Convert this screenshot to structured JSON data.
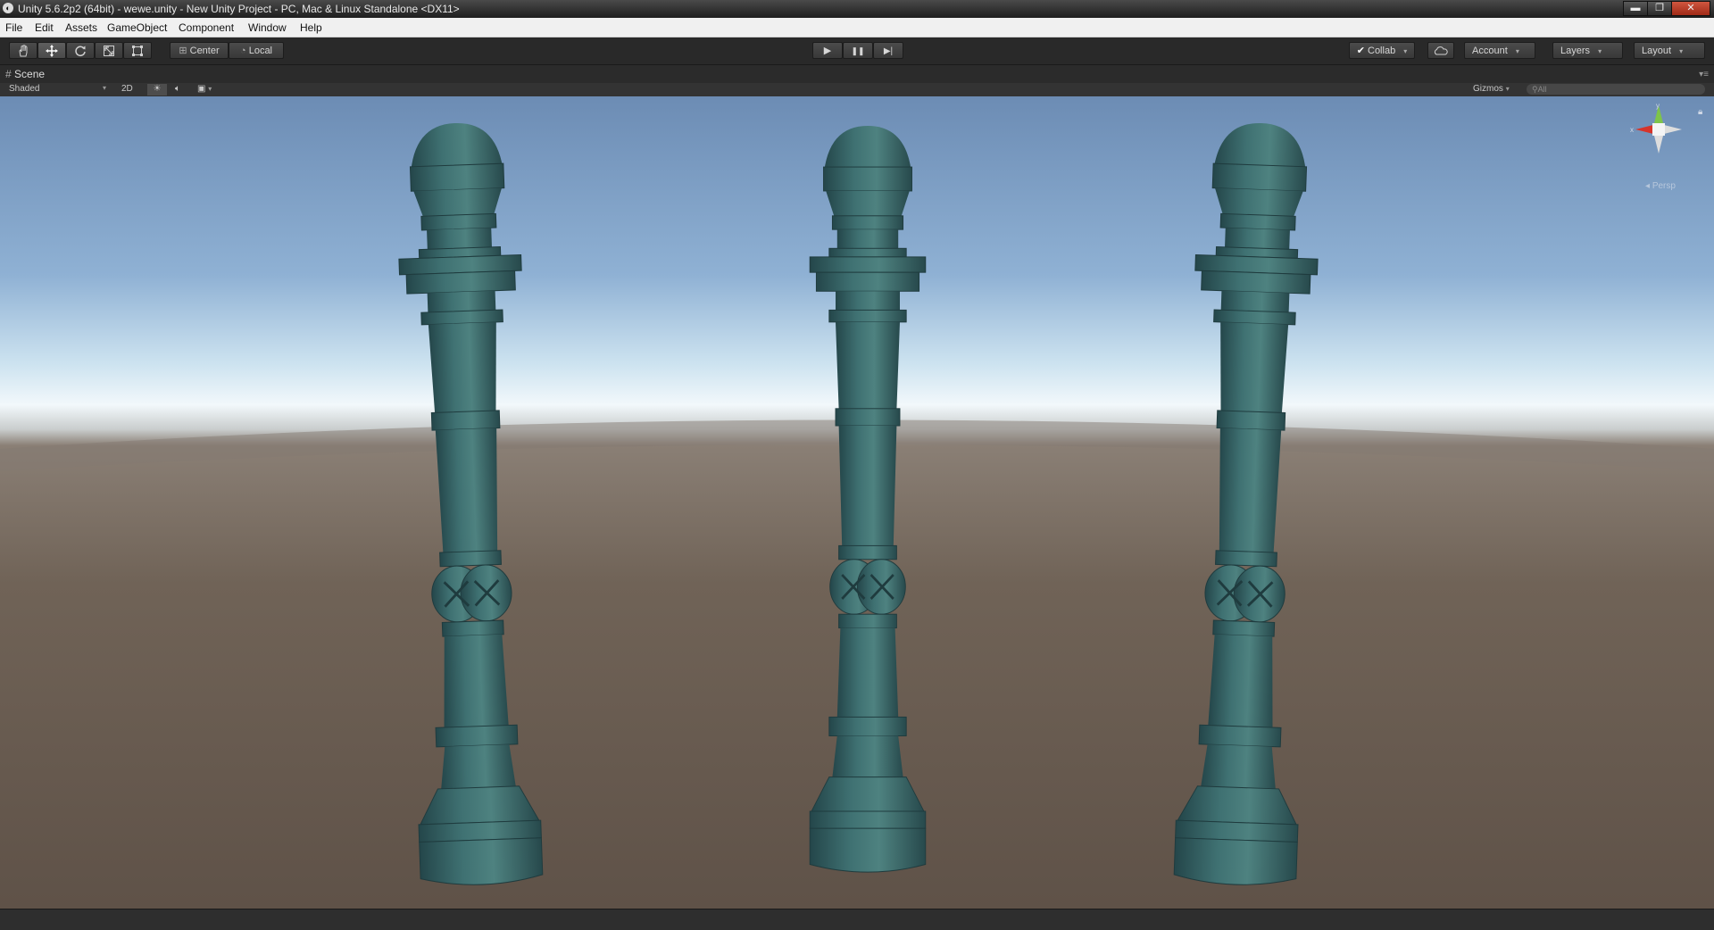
{
  "window": {
    "title": "Unity 5.6.2p2 (64bit) - wewe.unity - New Unity Project - PC, Mac & Linux Standalone <DX11>",
    "minimize": "▬",
    "maximize": "❐",
    "close": "✕"
  },
  "menu": [
    "File",
    "Edit",
    "Assets",
    "GameObject",
    "Component",
    "Window",
    "Help"
  ],
  "toolbar": {
    "tools": [
      "hand-icon",
      "move-icon",
      "rotate-icon",
      "scale-icon",
      "rect-icon"
    ],
    "pivot_label": "Center",
    "space_label": "Local",
    "play_icon": "▶",
    "pause_icon": "❚❚",
    "step_icon": "▶|",
    "collab_label": "Collab",
    "account_label": "Account",
    "layers_label": "Layers",
    "layout_label": "Layout"
  },
  "scene": {
    "tab_label": "Scene",
    "shading_mode": "Shaded",
    "toggle_2d": "2D",
    "gizmos_label": "Gizmos",
    "search_placeholder": "All",
    "projection_label": "Persp",
    "axis_x": "x",
    "axis_y": "y"
  },
  "colors": {
    "sky_top": "#6f90b8",
    "sky_horizon": "#eef6fb",
    "ground": "#6a5d52",
    "pillar": "#3b6a6a",
    "toolbar_bg": "#292929"
  }
}
